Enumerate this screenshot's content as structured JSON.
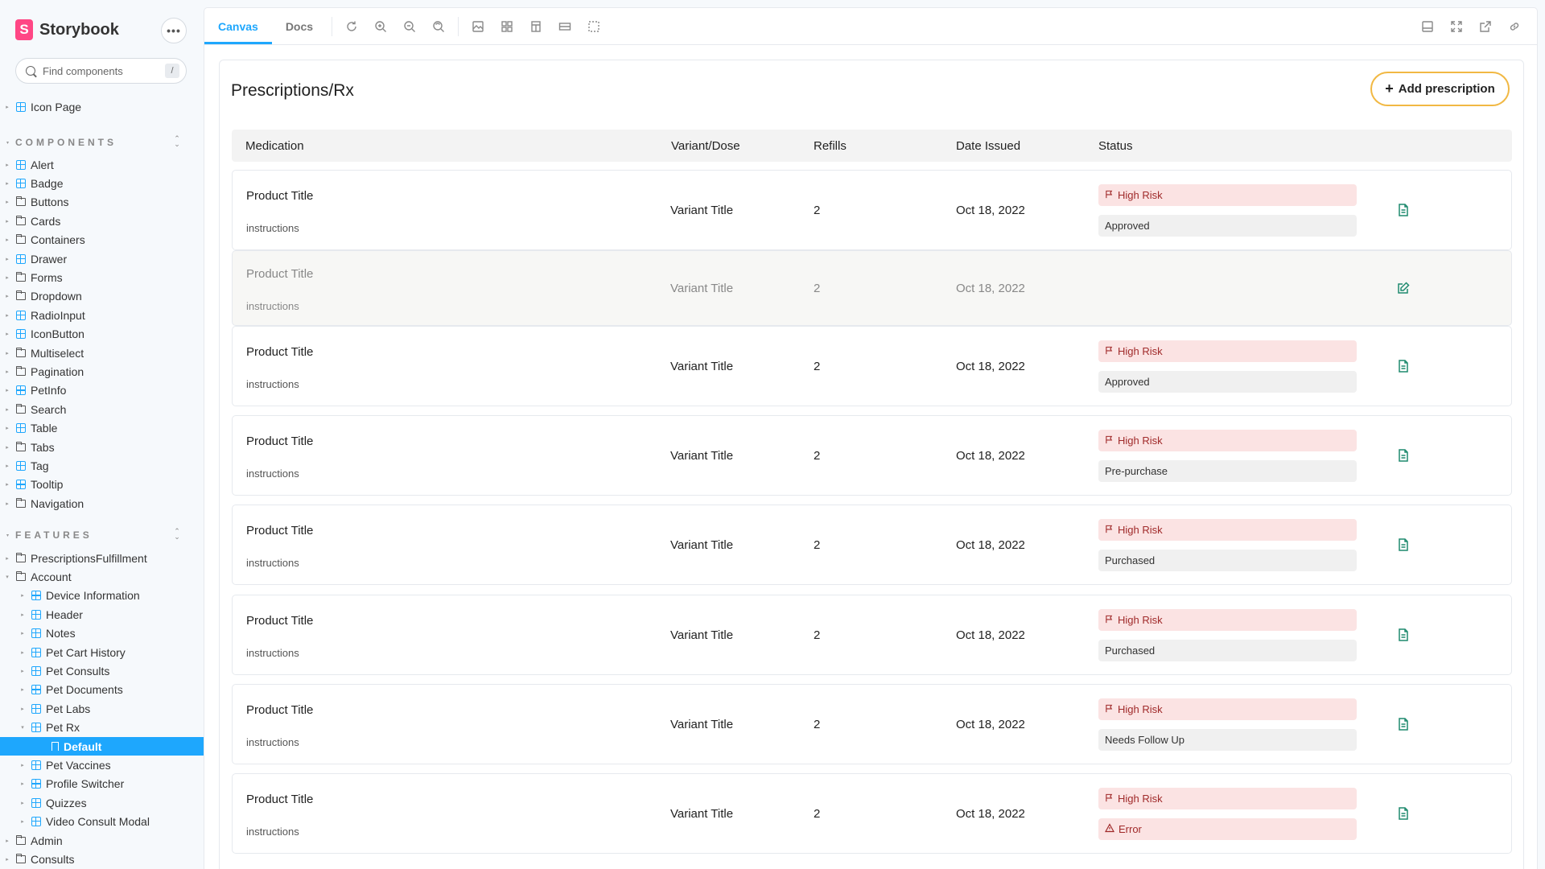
{
  "brand": {
    "name": "Storybook",
    "logo_letter": "S"
  },
  "search": {
    "placeholder": "Find components",
    "shortcut": "/"
  },
  "sidebar": {
    "top_items": [
      {
        "label": "Icon Page",
        "icon": "component-icon"
      }
    ],
    "components": {
      "title": "COMPONENTS",
      "items": [
        {
          "label": "Alert",
          "icon": "component-icon"
        },
        {
          "label": "Badge",
          "icon": "component-icon"
        },
        {
          "label": "Buttons",
          "icon": "folder-icon"
        },
        {
          "label": "Cards",
          "icon": "folder-icon"
        },
        {
          "label": "Containers",
          "icon": "folder-icon"
        },
        {
          "label": "Drawer",
          "icon": "component-icon"
        },
        {
          "label": "Forms",
          "icon": "folder-icon"
        },
        {
          "label": "Dropdown",
          "icon": "folder-icon"
        },
        {
          "label": "RadioInput",
          "icon": "component-icon"
        },
        {
          "label": "IconButton",
          "icon": "component-icon"
        },
        {
          "label": "Multiselect",
          "icon": "folder-icon"
        },
        {
          "label": "Pagination",
          "icon": "folder-icon"
        },
        {
          "label": "PetInfo",
          "icon": "component-icon"
        },
        {
          "label": "Search",
          "icon": "folder-icon"
        },
        {
          "label": "Table",
          "icon": "component-icon"
        },
        {
          "label": "Tabs",
          "icon": "folder-icon"
        },
        {
          "label": "Tag",
          "icon": "component-icon"
        },
        {
          "label": "Tooltip",
          "icon": "component-icon"
        },
        {
          "label": "Navigation",
          "icon": "folder-icon"
        }
      ]
    },
    "features": {
      "title": "FEATURES",
      "items": [
        {
          "label": "PrescriptionsFulfillment",
          "icon": "folder-icon",
          "level": 0
        },
        {
          "label": "Account",
          "icon": "folder-icon",
          "level": 0,
          "expanded": true
        },
        {
          "label": "Device Information",
          "icon": "component-icon",
          "level": 1
        },
        {
          "label": "Header",
          "icon": "component-icon",
          "level": 1
        },
        {
          "label": "Notes",
          "icon": "component-icon",
          "level": 1
        },
        {
          "label": "Pet Cart History",
          "icon": "component-icon",
          "level": 1
        },
        {
          "label": "Pet Consults",
          "icon": "component-icon",
          "level": 1
        },
        {
          "label": "Pet Documents",
          "icon": "component-icon",
          "level": 1
        },
        {
          "label": "Pet Labs",
          "icon": "component-icon",
          "level": 1
        },
        {
          "label": "Pet Rx",
          "icon": "component-icon",
          "level": 1,
          "expanded": true
        },
        {
          "label": "Default",
          "icon": "story-icon",
          "level": 2,
          "selected": true
        },
        {
          "label": "Pet Vaccines",
          "icon": "component-icon",
          "level": 1
        },
        {
          "label": "Profile Switcher",
          "icon": "component-icon",
          "level": 1
        },
        {
          "label": "Quizzes",
          "icon": "component-icon",
          "level": 1
        },
        {
          "label": "Video Consult Modal",
          "icon": "component-icon",
          "level": 1
        },
        {
          "label": "Admin",
          "icon": "folder-icon",
          "level": 0
        },
        {
          "label": "Consults",
          "icon": "folder-icon",
          "level": 0
        }
      ]
    }
  },
  "toolbar": {
    "tabs": [
      {
        "label": "Canvas",
        "active": true
      },
      {
        "label": "Docs",
        "active": false
      }
    ],
    "tools": [
      "reload-icon",
      "zoom-in-icon",
      "zoom-out-icon",
      "zoom-reset-icon",
      "background-icon",
      "grid-icon",
      "viewport-icon",
      "measure-icon",
      "outline-icon"
    ],
    "right_tools": [
      "panel-icon",
      "fullscreen-icon",
      "open-new-tab-icon",
      "copy-link-icon"
    ]
  },
  "canvas": {
    "title": "Prescriptions/Rx",
    "add_button": "Add prescription",
    "columns": [
      "Medication",
      "Variant/Dose",
      "Refills",
      "Date Issued",
      "Status"
    ],
    "rows": [
      {
        "title": "Product Title",
        "instructions": "instructions",
        "variant": "Variant Title",
        "refills": "2",
        "date": "Oct 18, 2022",
        "risk": "High Risk",
        "status": "Approved",
        "status_type": "neutral",
        "action_icon": "document-icon",
        "muted": false
      },
      {
        "title": "Product Title",
        "instructions": "instructions",
        "variant": "Variant Title",
        "refills": "2",
        "date": "Oct 18, 2022",
        "risk": "",
        "status": "",
        "status_type": "none",
        "action_icon": "edit-icon",
        "muted": true
      },
      {
        "title": "Product Title",
        "instructions": "instructions",
        "variant": "Variant Title",
        "refills": "2",
        "date": "Oct 18, 2022",
        "risk": "High Risk",
        "status": "Approved",
        "status_type": "neutral",
        "action_icon": "document-icon",
        "muted": false
      },
      {
        "title": "Product Title",
        "instructions": "instructions",
        "variant": "Variant Title",
        "refills": "2",
        "date": "Oct 18, 2022",
        "risk": "High Risk",
        "status": "Pre-purchase",
        "status_type": "neutral",
        "action_icon": "document-icon",
        "muted": false
      },
      {
        "title": "Product Title",
        "instructions": "instructions",
        "variant": "Variant Title",
        "refills": "2",
        "date": "Oct 18, 2022",
        "risk": "High Risk",
        "status": "Purchased",
        "status_type": "neutral",
        "action_icon": "document-icon",
        "muted": false
      },
      {
        "title": "Product Title",
        "instructions": "instructions",
        "variant": "Variant Title",
        "refills": "2",
        "date": "Oct 18, 2022",
        "risk": "High Risk",
        "status": "Purchased",
        "status_type": "neutral",
        "action_icon": "document-icon",
        "muted": false
      },
      {
        "title": "Product Title",
        "instructions": "instructions",
        "variant": "Variant Title",
        "refills": "2",
        "date": "Oct 18, 2022",
        "risk": "High Risk",
        "status": "Needs Follow Up",
        "status_type": "neutral",
        "action_icon": "document-icon",
        "muted": false
      },
      {
        "title": "Product Title",
        "instructions": "instructions",
        "variant": "Variant Title",
        "refills": "2",
        "date": "Oct 18, 2022",
        "risk": "High Risk",
        "status": "Error",
        "status_type": "error",
        "action_icon": "document-icon",
        "muted": false
      }
    ]
  },
  "colors": {
    "accent": "#1ea7fd",
    "brand": "#ff4785",
    "button_border": "#f1b843",
    "risk_bg": "#fbe3e3",
    "risk_text": "#a02a2a",
    "icon_green": "#1f8a6e"
  }
}
